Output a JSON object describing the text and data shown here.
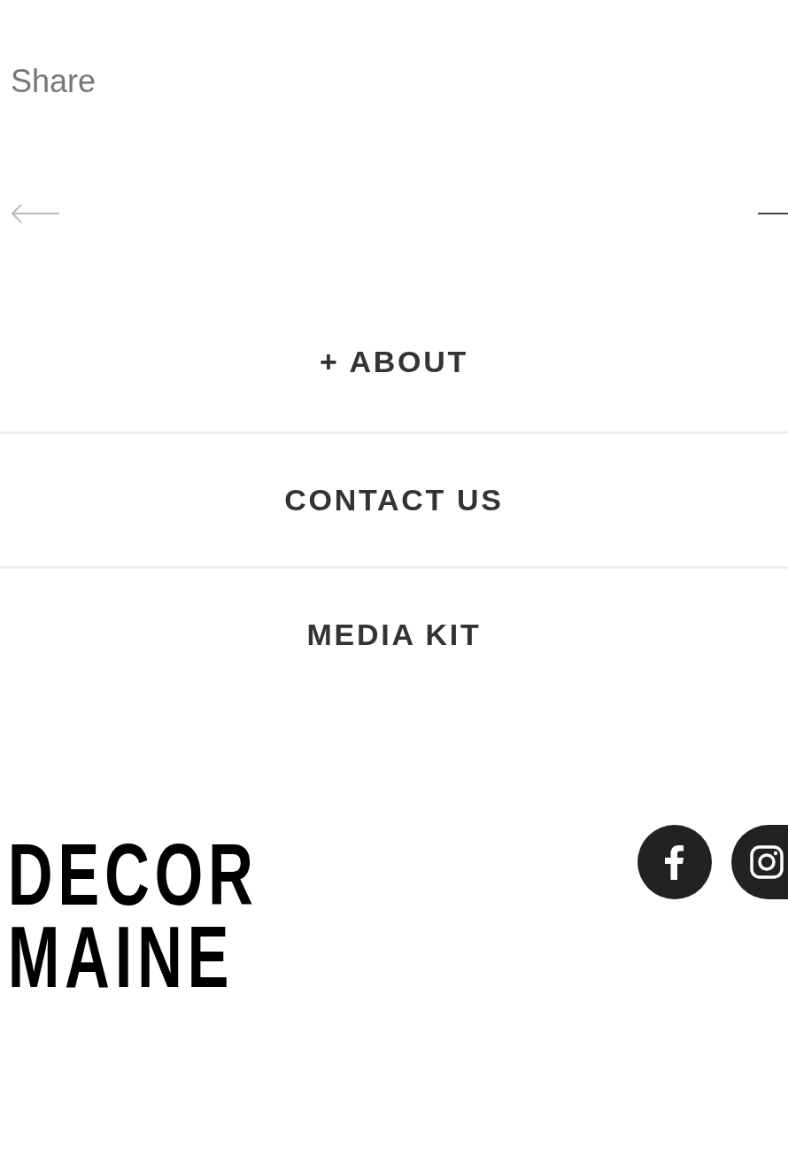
{
  "share": {
    "label": "Share"
  },
  "menu": [
    {
      "label": "+ ABOUT"
    },
    {
      "label": "CONTACT US"
    },
    {
      "label": "MEDIA KIT"
    }
  ],
  "logo": {
    "lines": [
      "DECOR",
      "MAINE"
    ]
  },
  "social": [
    {
      "kind": "facebook"
    },
    {
      "kind": "instagram"
    }
  ]
}
